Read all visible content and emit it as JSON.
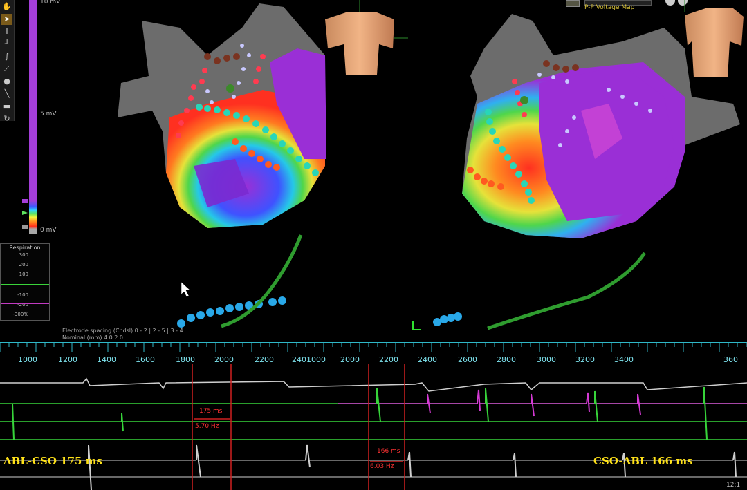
{
  "map": {
    "title": "P-P Voltage Map"
  },
  "scale": {
    "top_label": "10 mV",
    "mid_label": "5 mV",
    "bottom_label": "0 mV"
  },
  "respiration": {
    "title": "Respiration",
    "values": [
      "300",
      "200",
      "100",
      "-100",
      "-200",
      "-300%"
    ]
  },
  "electrode_spacing": {
    "line1": "Electrode spacing  (Chdsl)  0 - 2 | 2 - 5 | 3 - 4",
    "line2": "Nominal (mm)       4.0      2.0"
  },
  "ruler": {
    "labels": [
      "1000",
      "1200",
      "1400",
      "1600",
      "1800",
      "2000",
      "2200",
      "2401000",
      "2000",
      "2200",
      "2400",
      "2600",
      "2800",
      "3000",
      "3200",
      "3400",
      "360"
    ]
  },
  "measurements": {
    "left_ms": "175 ms",
    "left_hz": "5.70 Hz",
    "right_ms": "166 ms",
    "right_hz": "6.03 Hz"
  },
  "ecg_labels": {
    "left": "ABL-CSO 175 ms",
    "right": "CSO-ABL 166 ms"
  },
  "clock": "12:1",
  "colors": {
    "accent_cyan": "#7ee3ee",
    "trace_green": "#37d43a",
    "trace_magenta": "#d43ad4",
    "label_yellow": "#ffe21a",
    "marker_red": "#ff3333"
  },
  "icons": [
    "hand-icon",
    "pointer-icon",
    "caliper-icon",
    "line-icon",
    "curve-icon",
    "measure-icon",
    "brush-icon",
    "needle-icon",
    "dash-icon",
    "rotate-icon"
  ]
}
